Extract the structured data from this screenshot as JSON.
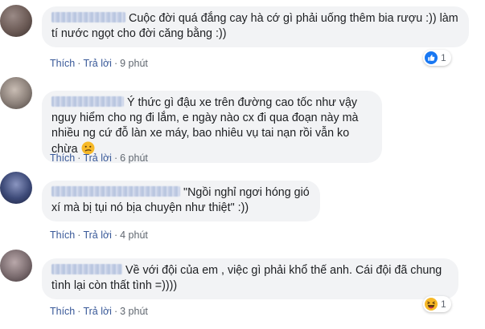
{
  "comments": [
    {
      "text": "Cuộc đời quá đắng cay hà cớ gì phải uống thêm bia rượu :)) làm tí nước ngọt cho đời căng bằng :))",
      "like_label": "Thích",
      "reply_label": "Trả lời",
      "time": "9 phút",
      "reaction": {
        "icon": "like-icon",
        "count": "1"
      },
      "avatar_color": "#6b5a55"
    },
    {
      "text": "Ý thức gì đậu xe trên đường cao tốc như vậy nguy hiểm cho ng đi lắm, e ngày nào cx đi qua đoạn này mà nhiều ng cứ đỗ làn xe máy, bao nhiêu vụ tai nạn rồi vẫn ko chừa",
      "emoji": "confused-face-emoji",
      "like_label": "Thích",
      "reply_label": "Trả lời",
      "time": "6 phút",
      "avatar_color": "#8a7f78"
    },
    {
      "text": "\"Ngồi nghỉ ngơi hóng gió xí mà bị tụi nó bịa chuyện như thiệt\" :))",
      "like_label": "Thích",
      "reply_label": "Trả lời",
      "time": "4 phút",
      "avatar_color": "#3d4a78"
    },
    {
      "text": "Về với đội của em , việc gì phải khổ thế anh. Cái đội đã chung tình lại còn thất tình =))))",
      "like_label": "Thích",
      "reply_label": "Trả lời",
      "time": "3 phút",
      "reaction": {
        "icon": "haha-icon",
        "count": "1"
      },
      "avatar_color": "#7a6b6e"
    }
  ],
  "colors": {
    "bubble": "#f2f3f5",
    "link": "#385898",
    "meta": "#606770",
    "like_blue": "#1877f2",
    "haha_yellow": "#f7b928"
  }
}
